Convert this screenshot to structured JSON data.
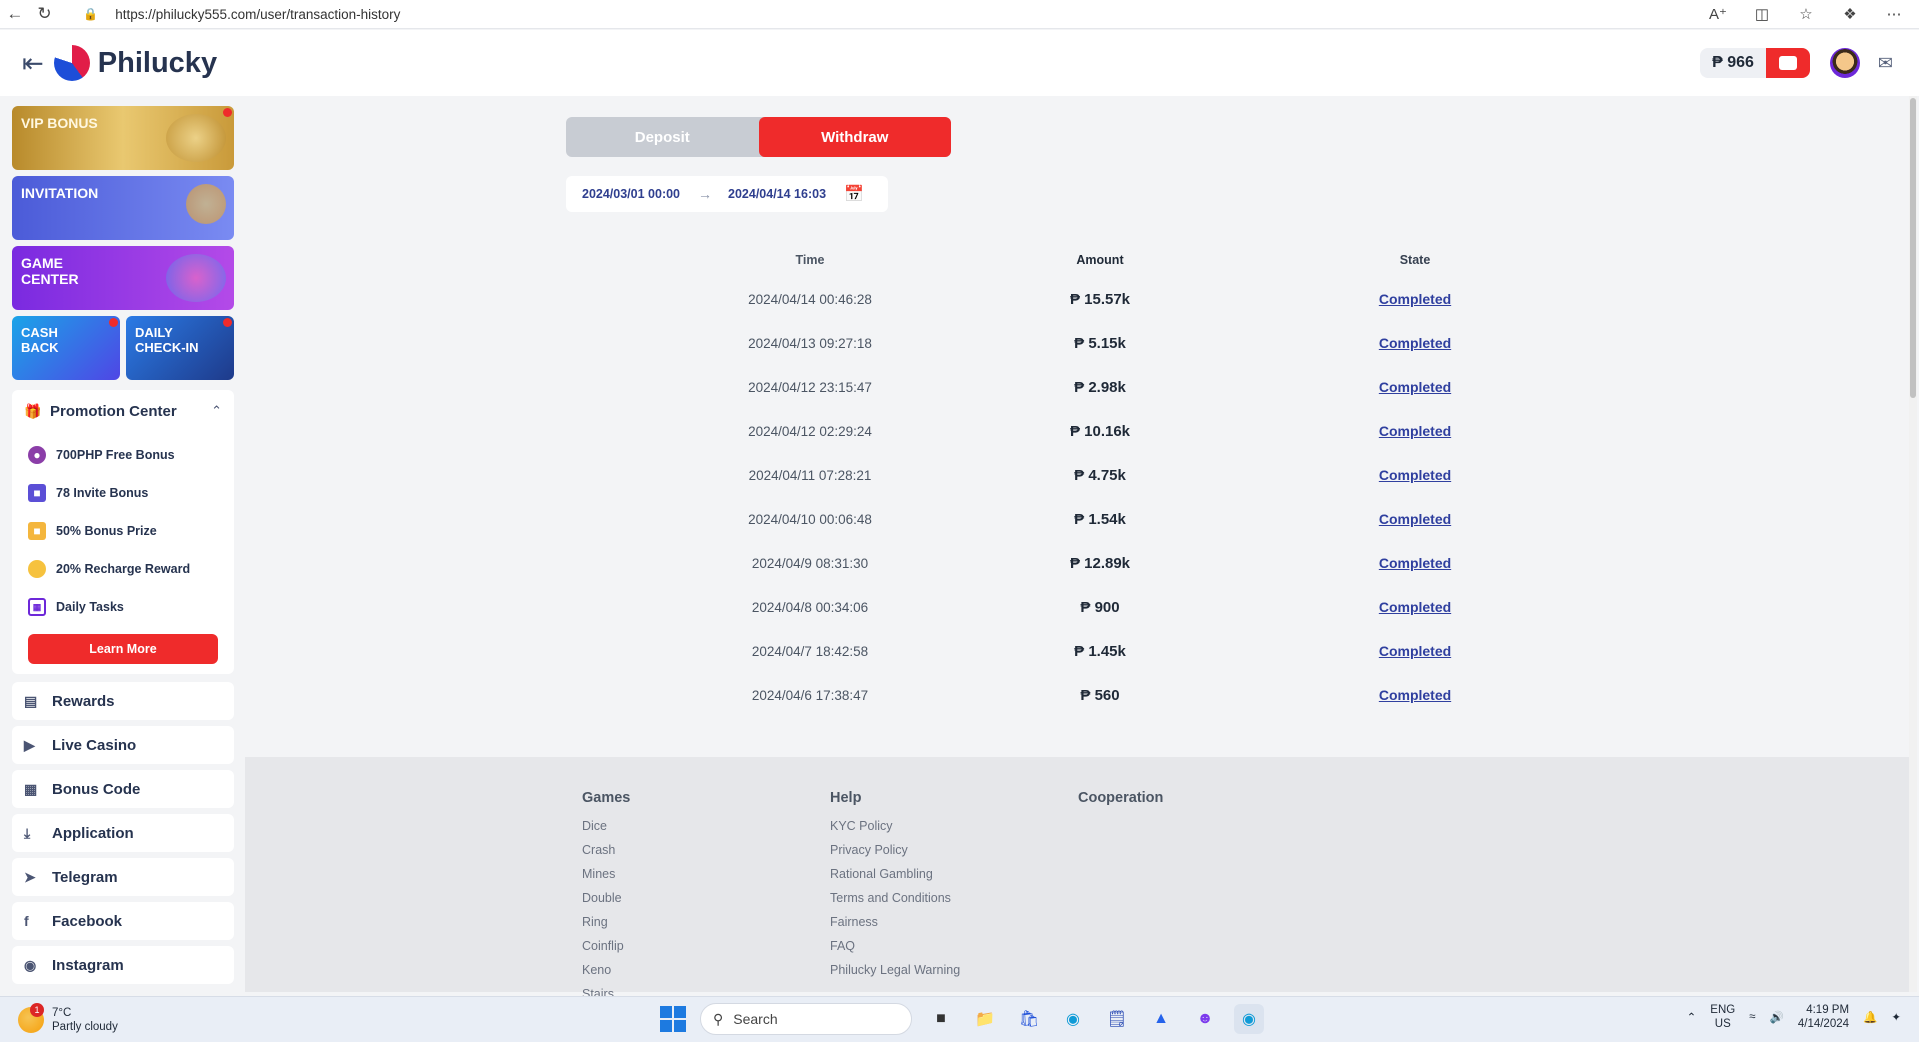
{
  "browser": {
    "url": "https://philucky555.com/user/transaction-history",
    "icons": [
      "back-icon",
      "refresh-icon",
      "lock-icon",
      "read-aloud-icon",
      "split-screen-icon",
      "favorites-icon",
      "collections-icon",
      "more-icon"
    ]
  },
  "header": {
    "brand": "Philucky",
    "balance": "₱ 966",
    "icons": [
      "menu-collapse-icon",
      "wallet-icon",
      "avatar",
      "mail-icon"
    ]
  },
  "sidebar": {
    "banners": [
      {
        "label": "VIP BONUS"
      },
      {
        "label": "INVITATION"
      },
      {
        "label": "GAME CENTER"
      }
    ],
    "mini_banners": [
      {
        "label": "CASH BACK"
      },
      {
        "label": "DAILY CHECK-IN"
      }
    ],
    "promotion_center": {
      "title": "Promotion Center",
      "items": [
        {
          "label": "700PHP Free Bonus"
        },
        {
          "label": "78 Invite Bonus"
        },
        {
          "label": "50% Bonus Prize"
        },
        {
          "label": "20% Recharge Reward"
        },
        {
          "label": "Daily Tasks"
        }
      ],
      "learn_more": "Learn More"
    },
    "links": [
      {
        "label": "Rewards"
      },
      {
        "label": "Live Casino"
      },
      {
        "label": "Bonus Code"
      },
      {
        "label": "Application"
      },
      {
        "label": "Telegram"
      },
      {
        "label": "Facebook"
      },
      {
        "label": "Instagram"
      }
    ]
  },
  "main": {
    "tabs": [
      {
        "label": "Deposit",
        "active": false
      },
      {
        "label": "Withdraw",
        "active": true
      }
    ],
    "date_start": "2024/03/01 00:00",
    "date_end": "2024/04/14 16:03",
    "columns": [
      "Time",
      "Amount",
      "State"
    ],
    "rows": [
      {
        "time": "2024/04/14 00:46:28",
        "amount": "₱ 15.57k",
        "state": "Completed"
      },
      {
        "time": "2024/04/13 09:27:18",
        "amount": "₱ 5.15k",
        "state": "Completed"
      },
      {
        "time": "2024/04/12 23:15:47",
        "amount": "₱ 2.98k",
        "state": "Completed"
      },
      {
        "time": "2024/04/12 02:29:24",
        "amount": "₱ 10.16k",
        "state": "Completed"
      },
      {
        "time": "2024/04/11 07:28:21",
        "amount": "₱ 4.75k",
        "state": "Completed"
      },
      {
        "time": "2024/04/10 00:06:48",
        "amount": "₱ 1.54k",
        "state": "Completed"
      },
      {
        "time": "2024/04/9 08:31:30",
        "amount": "₱ 12.89k",
        "state": "Completed"
      },
      {
        "time": "2024/04/8 00:34:06",
        "amount": "₱ 900",
        "state": "Completed"
      },
      {
        "time": "2024/04/7 18:42:58",
        "amount": "₱ 1.45k",
        "state": "Completed"
      },
      {
        "time": "2024/04/6 17:38:47",
        "amount": "₱ 560",
        "state": "Completed"
      }
    ]
  },
  "footer": {
    "games": {
      "title": "Games",
      "links": [
        "Dice",
        "Crash",
        "Mines",
        "Double",
        "Ring",
        "Coinflip",
        "Keno",
        "Stairs"
      ]
    },
    "help": {
      "title": "Help",
      "links": [
        "KYC Policy",
        "Privacy Policy",
        "Rational Gambling",
        "Terms and Conditions",
        "Fairness",
        "FAQ",
        "Philucky Legal Warning"
      ]
    },
    "cooperation": {
      "title": "Cooperation"
    }
  },
  "taskbar": {
    "weather_temp": "7°C",
    "weather_desc": "Partly cloudy",
    "weather_badge": "1",
    "search_placeholder": "Search",
    "lang_top": "ENG",
    "lang_bottom": "US",
    "time": "4:19 PM",
    "date": "4/14/2024"
  },
  "colors": {
    "accent": "#ef2b2b",
    "link": "#2f3f9f",
    "brand_text": "#26334f"
  }
}
